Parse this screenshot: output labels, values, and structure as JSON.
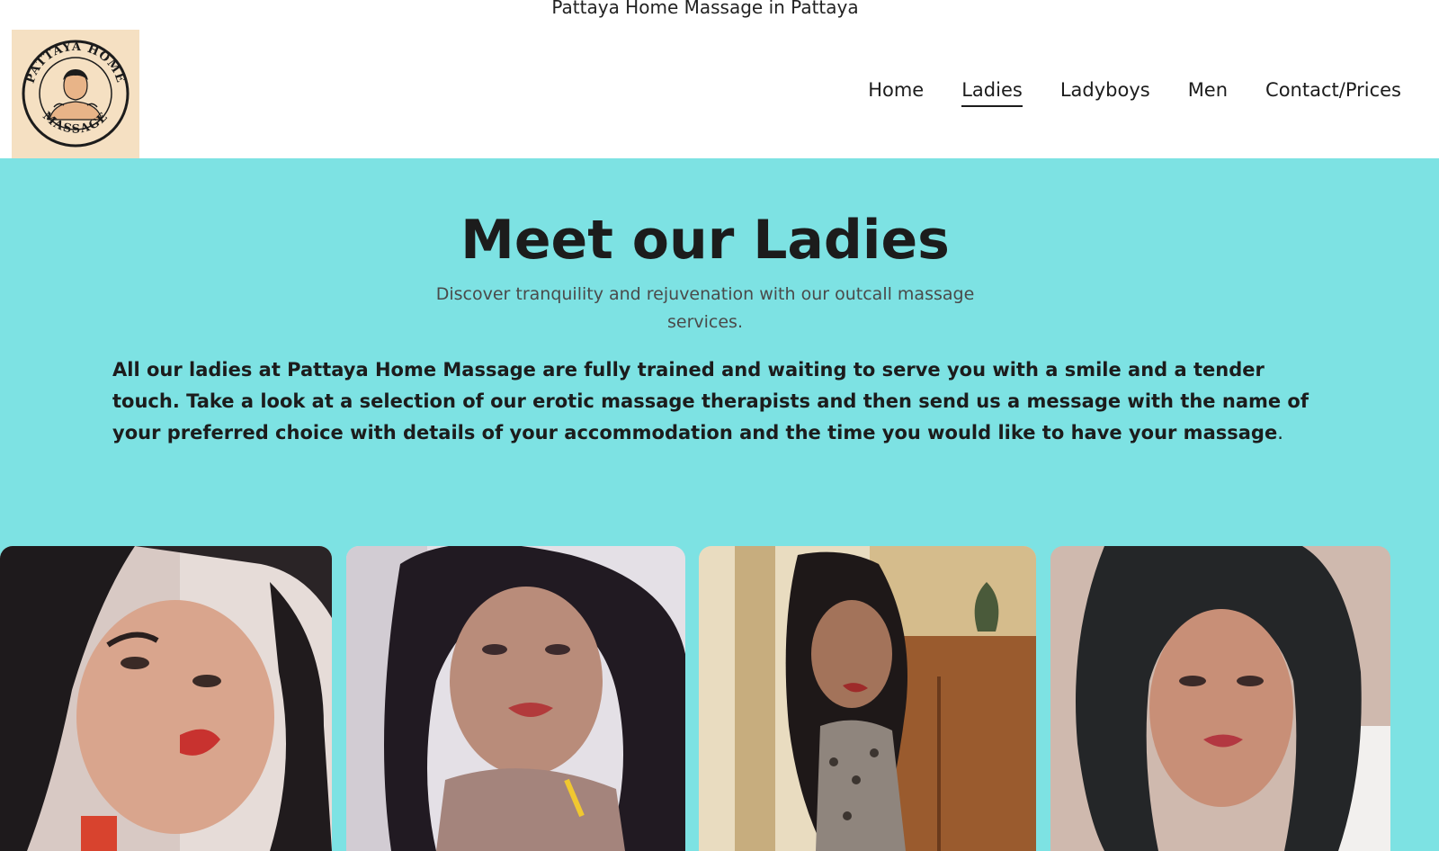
{
  "site": {
    "title": "Pattaya Home Massage in Pattaya"
  },
  "logo": {
    "alt": "PATTAYA HOME MASSAGE"
  },
  "nav": {
    "items": [
      {
        "label": "Home",
        "active": false
      },
      {
        "label": "Ladies",
        "active": true
      },
      {
        "label": "Ladyboys",
        "active": false
      },
      {
        "label": "Men",
        "active": false
      },
      {
        "label": "Contact/Prices",
        "active": false
      }
    ]
  },
  "hero": {
    "title": "Meet our Ladies",
    "subtitle": "Discover tranquility and rejuvenation with our outcall massage services.",
    "body": "All our ladies at Pattaya Home Massage are fully trained and waiting to serve you with a smile and a tender touch. Take a look at a selection of our erotic massage therapists and then send us a message with the name of your preferred choice with details of your accommodation and the time you would like to have your massage",
    "body_end": "."
  },
  "colors": {
    "hero_bg": "#7de2e3",
    "logo_bg": "#f5e0c2",
    "text": "#1c1c1c"
  },
  "gallery": {
    "cards": [
      {
        "name": "lady-photo-1"
      },
      {
        "name": "lady-photo-2"
      },
      {
        "name": "lady-photo-3"
      },
      {
        "name": "lady-photo-4"
      }
    ]
  }
}
